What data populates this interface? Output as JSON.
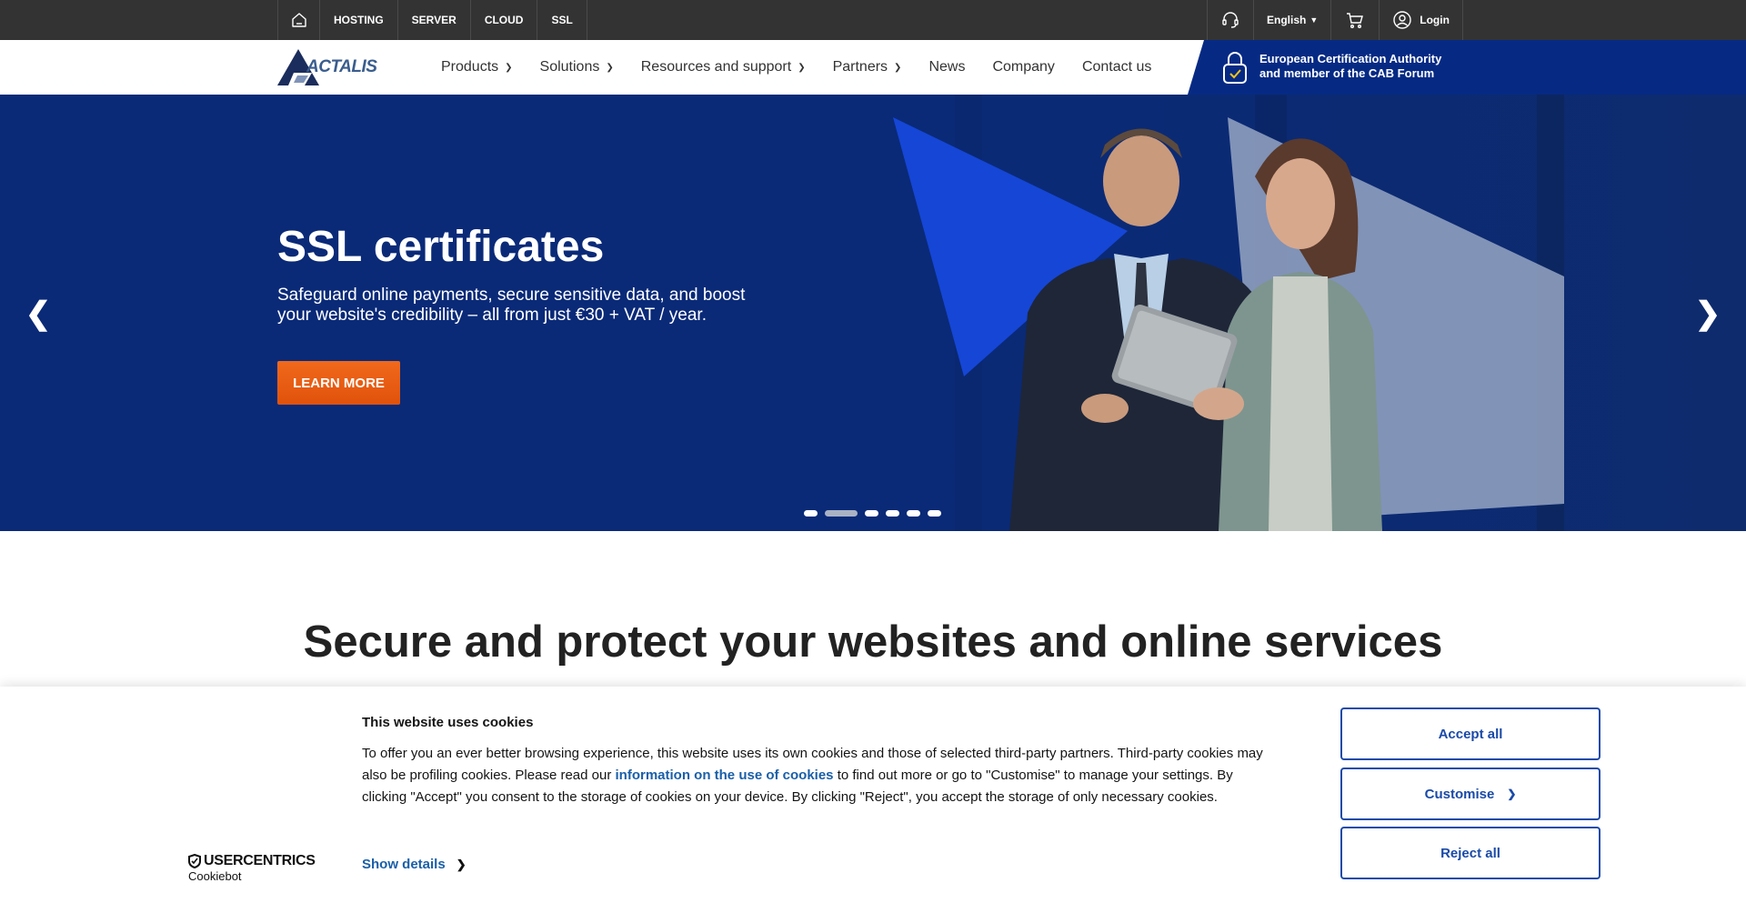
{
  "topbar": {
    "items": [
      "HOSTING",
      "SERVER",
      "CLOUD",
      "SSL"
    ],
    "language": "English",
    "login": "Login"
  },
  "nav": {
    "logo": "ACTALIS",
    "items": [
      {
        "label": "Products",
        "dropdown": true
      },
      {
        "label": "Solutions",
        "dropdown": true
      },
      {
        "label": "Resources and support",
        "dropdown": true
      },
      {
        "label": "Partners",
        "dropdown": true
      },
      {
        "label": "News",
        "dropdown": false
      },
      {
        "label": "Company",
        "dropdown": false
      },
      {
        "label": "Contact us",
        "dropdown": false
      }
    ],
    "cab_line1": "European Certification Authority",
    "cab_line2": "and member of the CAB Forum"
  },
  "hero": {
    "title": "SSL certificates",
    "subtitle": "Safeguard online payments, secure sensitive data, and boost your website's credibility – all from just €30 + VAT / year.",
    "cta": "LEARN MORE",
    "slide_count": 6,
    "active_slide": 2
  },
  "section": {
    "title": "Secure and protect your websites and online services"
  },
  "cookie": {
    "title": "This website uses cookies",
    "text_before": "To offer you an ever better browsing experience, this website uses its own cookies and those of selected third-party partners. Third-party cookies may also be profiling cookies. Please read our ",
    "link": "information on the use of cookies",
    "text_after": " to find out more or go to \"Customise\" to manage your settings. By clicking \"Accept\" you consent to the storage of cookies on your device. By clicking \"Reject\", you accept the storage of only necessary cookies.",
    "show_details": "Show details",
    "accept": "Accept all",
    "customise": "Customise",
    "reject": "Reject all",
    "brand_line1": "USERCENTRICS",
    "brand_line2": "Cookiebot"
  },
  "colors": {
    "topbar": "#333333",
    "navy": "#062a84",
    "cta": "#e8590f",
    "cookie_accent": "#1a4aa8"
  }
}
